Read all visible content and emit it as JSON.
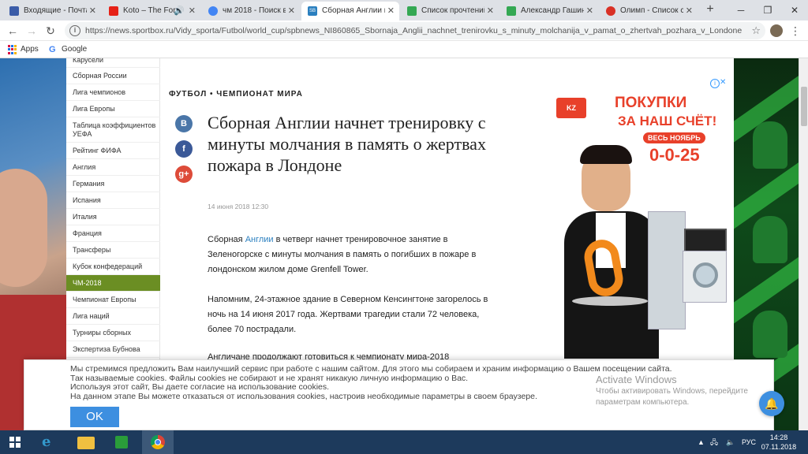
{
  "browser": {
    "tabs": [
      {
        "label": "Входящие - Почта",
        "color": "#3b5ca8"
      },
      {
        "label": "Koto – The For",
        "color": "#e62117"
      },
      {
        "label": "чм 2018 - Поиск в",
        "color": "#4285f4"
      },
      {
        "label": "Сборная Англии н",
        "color": "#2a7fbf"
      },
      {
        "label": "Список прочтений",
        "color": "#34a853"
      },
      {
        "label": "Александр Гашин",
        "color": "#34a853"
      },
      {
        "label": "Олимп - Список с",
        "color": "#d93025"
      }
    ],
    "new_tab": "+",
    "url": "https://news.sportbox.ru/Vidy_sporta/Futbol/world_cup/spbnews_NI860865_Sbornaja_Anglii_nachnet_trenirovku_s_minuty_molchanija_v_pamat_o_zhertvah_pozhara_v_Londone",
    "bookmarks": [
      {
        "label": "Apps"
      },
      {
        "label": "Google"
      }
    ]
  },
  "sidebar": {
    "items": [
      {
        "label": "Карусели"
      },
      {
        "label": "Сборная России"
      },
      {
        "label": "Лига чемпионов"
      },
      {
        "label": "Лига Европы"
      },
      {
        "label": "Таблица коэффициентов УЕФА"
      },
      {
        "label": "Рейтинг ФИФА"
      },
      {
        "label": "Англия"
      },
      {
        "label": "Германия"
      },
      {
        "label": "Испания"
      },
      {
        "label": "Италия"
      },
      {
        "label": "Франция"
      },
      {
        "label": "Трансферы"
      },
      {
        "label": "Кубок конфедераций"
      },
      {
        "label": "ЧМ-2018",
        "active": true
      },
      {
        "label": "Чемпионат Европы"
      },
      {
        "label": "Лига наций"
      },
      {
        "label": "Турниры сборных"
      },
      {
        "label": "Экспертиза Бубнова"
      }
    ]
  },
  "article": {
    "rubric": "ФУТБОЛ • ЧЕМПИОНАТ МИРА",
    "title": "Сборная Англии начнет тренировку с минуты молчания в память о жертвах пожара в Лондоне",
    "date": "14 июня 2018 12:30",
    "share": [
      {
        "label": "В",
        "color": "#4a76a8"
      },
      {
        "label": "f",
        "color": "#3b5998"
      },
      {
        "label": "g+",
        "color": "#dd4b39"
      }
    ],
    "p1_before": "Сборная ",
    "p1_link": "Англии",
    "p1_after": " в четверг начнет тренировочное занятие в Зеленогорске с минуты молчания в память о погибших в пожаре в лондонском жилом доме Grenfell Tower.",
    "p2": "Напомним, 24-этажное здание в Северном Кенсингтоне загорелось в ночь на 14 июня 2017 года. Жертвами трагедии стали 72 человека, более 70 пострадали.",
    "p3": "Англичане продолжают готовиться к чемпионату мира-2018"
  },
  "ad": {
    "logo": "KZ",
    "line1": "ПОКУПКИ",
    "line2": "ЗА НАШ СЧЁТ!",
    "line3": "ВЕСЬ НОЯБРЬ",
    "line4": "0-0-25"
  },
  "cookie": {
    "line1": "Мы стремимся предложить Вам наилучший сервис при работе с нашим сайтом. Для этого мы собираем и храним информацию о Вашем посещении сайта.",
    "line2": "Так называемые cookies. Файлы cookies не собирают и не хранят никакую личную информацию о Вас.",
    "line3": "Используя этот сайт, Вы даете согласие на использование cookies.",
    "line4": "На данном этапе Вы можете отказаться от использования cookies, настроив необходимые параметры в своем браузере.",
    "ok": "OK"
  },
  "watermark": {
    "title": "Activate Windows",
    "line1": "Чтобы активировать Windows, перейдите",
    "line2": "параметрам компьютера."
  },
  "taskbar": {
    "lang": "РУС",
    "time": "14:28",
    "date": "07.11.2018"
  }
}
